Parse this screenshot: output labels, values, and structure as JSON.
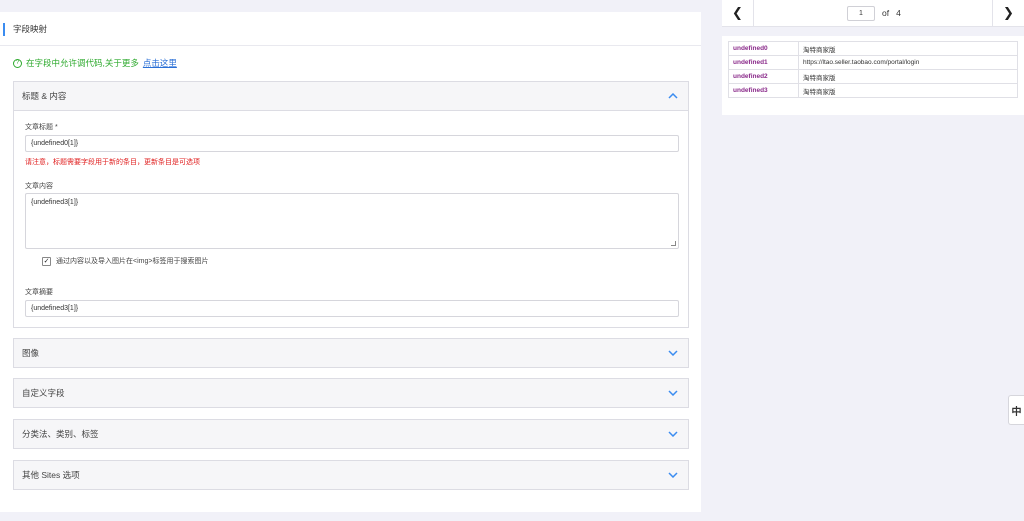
{
  "panel": {
    "title": "字段映射"
  },
  "help": {
    "icon": "question-circle-icon",
    "text": "在字段中允许调代码,关于更多",
    "link": "点击这里"
  },
  "sections": {
    "title_content": {
      "label": "标题 & 内容",
      "expanded": true,
      "post_title_label": "文章标题 *",
      "post_title_value": "{undefined0[1]}",
      "warning": "请注意，标题需要字段用于新的条目，更新条目是可选项",
      "post_content_label": "文章内容",
      "post_content_value": "{undefined3[1]}",
      "checkbox_label": "通过内容以及导入图片在<img>标签用于搜索图片",
      "checkbox_checked": true,
      "excerpt_label": "文章摘要",
      "excerpt_value": "{undefined3[1]}"
    },
    "images": {
      "label": "图像"
    },
    "custom_fields": {
      "label": "自定义字段"
    },
    "taxonomies": {
      "label": "分类法、类别、标签"
    },
    "other": {
      "label": "其他 Sites 选项"
    }
  },
  "pager": {
    "prev_icon": "chevron-left-icon",
    "next_icon": "chevron-right-icon",
    "current": "1",
    "of_label": "of",
    "total": "4"
  },
  "records": [
    {
      "key": "undefined0",
      "value": "淘特商家版"
    },
    {
      "key": "undefined1",
      "value": "https://ltao.seller.taobao.com/portal/login"
    },
    {
      "key": "undefined2",
      "value": "淘特商家版"
    },
    {
      "key": "undefined3",
      "value": "淘特商家版"
    }
  ],
  "side_handle": {
    "glyph": "中"
  },
  "colors": {
    "accent": "#3b8cf0",
    "help_green": "#2eaa2e",
    "warning_red": "#e02020",
    "record_key": "#8a2a8a"
  }
}
